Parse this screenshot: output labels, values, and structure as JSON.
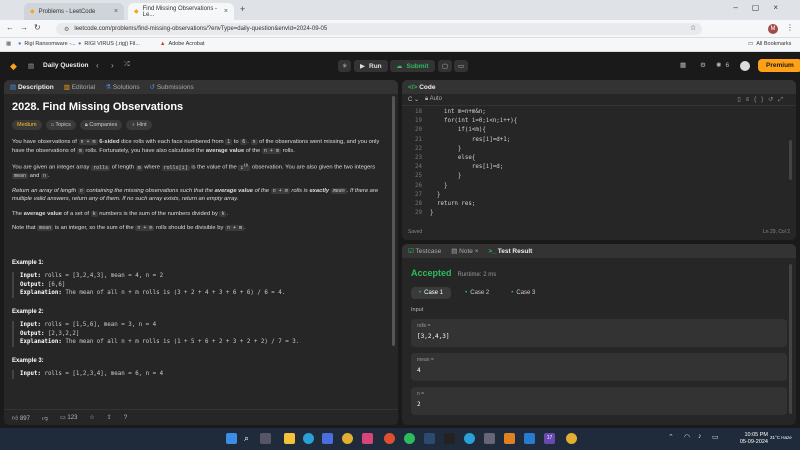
{
  "browser": {
    "tabs": [
      {
        "title": "Problems - LeetCode",
        "active": false
      },
      {
        "title": "Find Missing Observations - Le...",
        "active": true
      }
    ],
    "url": "leetcode.com/problems/find-missing-observations/?envType=daily-question&envId=2024-09-05",
    "bookmarks": [
      "Rigi Ransomware -...",
      "RIGI VIRUS (.rigj) Fil...",
      "Adobe Acrobat"
    ],
    "all_bookmarks_label": "All Bookmarks",
    "profile_initial": "M"
  },
  "header": {
    "daily_question": "Daily Question",
    "run_label": "Run",
    "submit_label": "Submit",
    "streak": "6",
    "premium_label": "Premium"
  },
  "description": {
    "tabs": [
      "Description",
      "Editorial",
      "Solutions",
      "Submissions"
    ],
    "title": "2028. Find Missing Observations",
    "chips": [
      "Medium",
      "Topics",
      "Companies",
      "Hint"
    ],
    "likes": "897",
    "comments": "123",
    "examples": [
      {
        "title": "Example 1:",
        "input": "rolls = [3,2,4,3], mean = 4, n = 2",
        "output": "[6,6]",
        "explanation": "The mean of all n + m rolls is (3 + 2 + 4 + 3 + 6 + 6) / 6 = 4."
      },
      {
        "title": "Example 2:",
        "input": "rolls = [1,5,6], mean = 3, n = 4",
        "output": "[2,3,2,2]",
        "explanation": "The mean of all n + m rolls is (1 + 5 + 6 + 2 + 3 + 2 + 2) / 7 = 3."
      },
      {
        "title": "Example 3:",
        "input": "rolls = [1,2,3,4], mean = 6, n = 4"
      }
    ]
  },
  "code": {
    "title": "Code",
    "lang": "Auto",
    "status": "Saved",
    "cursor": "Ln 29, Col 2",
    "lines": [
      {
        "n": "18",
        "text": "    int m=n+m&n;"
      },
      {
        "n": "19",
        "text": "    for(int i=0;i<n;i++){"
      },
      {
        "n": "20",
        "text": "        if(i<m){"
      },
      {
        "n": "21",
        "text": "            res[i]=d+1;"
      },
      {
        "n": "22",
        "text": "        }"
      },
      {
        "n": "23",
        "text": "        else{"
      },
      {
        "n": "24",
        "text": "            res[i]=d;"
      },
      {
        "n": "25",
        "text": "        }"
      },
      {
        "n": "26",
        "text": "    }"
      },
      {
        "n": "27",
        "text": "  }"
      },
      {
        "n": "28",
        "text": "  return res;"
      },
      {
        "n": "29",
        "text": "}"
      }
    ]
  },
  "result": {
    "tabs": [
      "Testcase",
      "Note",
      "Test Result"
    ],
    "verdict": "Accepted",
    "runtime": "Runtime: 2 ms",
    "cases": [
      "Case 1",
      "Case 2",
      "Case 3"
    ],
    "input_label": "Input",
    "vars": [
      {
        "label": "rolls =",
        "value": "[3,2,4,3]"
      },
      {
        "label": "mean =",
        "value": "4"
      },
      {
        "label": "n =",
        "value": "2"
      }
    ]
  },
  "taskbar": {
    "time": "10:05 PM",
    "date": "05-09-2024",
    "weather": "31°C Haze",
    "badge": "17"
  }
}
